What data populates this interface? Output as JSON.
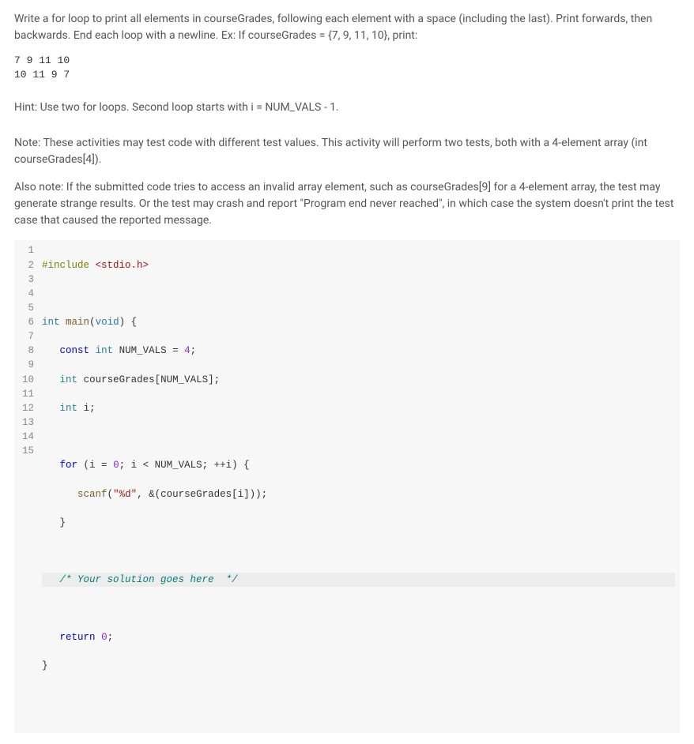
{
  "problem": {
    "intro": "Write a for loop to print all elements in courseGrades, following each element with a space (including the last). Print forwards, then backwards. End each loop with a newline. Ex: If courseGrades = {7, 9, 11, 10}, print:",
    "sample_output": "7 9 11 10\n10 11 9 7",
    "hint": "Hint: Use two for loops. Second loop starts with i = NUM_VALS - 1.",
    "note1": "Note: These activities may test code with different test values. This activity will perform two tests, both with a 4-element array (int courseGrades[4]).",
    "note2": "Also note: If the submitted code tries to access an invalid array element, such as courseGrades[9] for a 4-element array, the test may generate strange results. Or the test may crash and report \"Program end never reached\", in which case the system doesn't print the test case that caused the reported message."
  },
  "code": {
    "line_count": 15,
    "lines": {
      "l1_include": "#include",
      "l1_header": "<stdio.h>",
      "l3_int": "int",
      "l3_main": "main",
      "l3_void": "void",
      "l4_const": "const",
      "l4_int": "int",
      "l4_numvals": "NUM_VALS = ",
      "l4_val": "4",
      "l5_int": "int",
      "l5_decl": "courseGrades[NUM_VALS];",
      "l6_int": "int",
      "l6_i": "i;",
      "l8_for": "for",
      "l8_cond": " (i = ",
      "l8_zero": "0",
      "l8_cond2": "; i < NUM_VALS; ++i) {",
      "l9_scanf": "scanf",
      "l9_fmt": "\"%d\"",
      "l9_rest": ", &(courseGrades[i]));",
      "l10_brace": "}",
      "l12_comment": "/* Your solution goes here  */",
      "l14_return": "return",
      "l14_zero": "0",
      "l15_brace": "}"
    }
  }
}
